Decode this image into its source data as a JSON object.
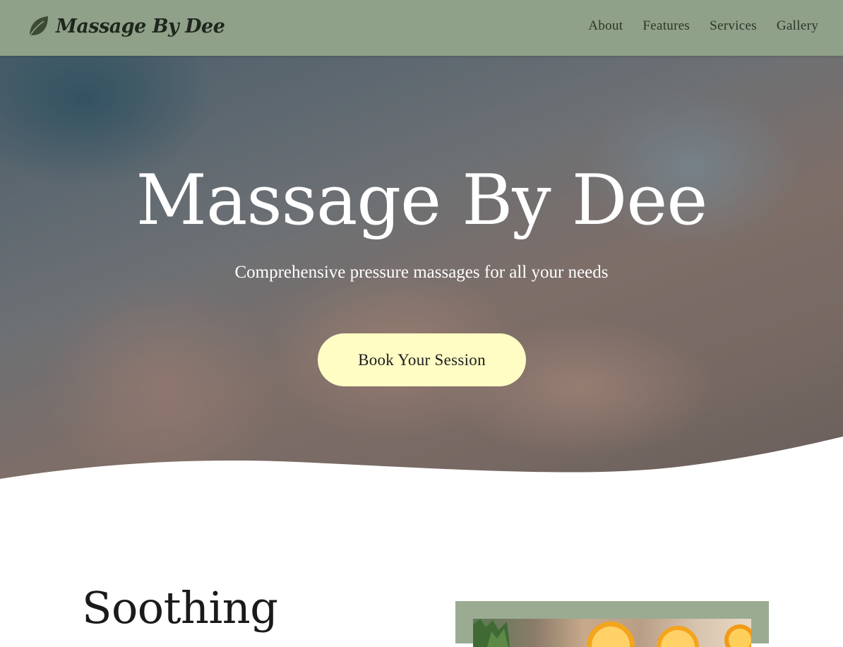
{
  "header": {
    "brand": "Massage By Dee",
    "logo_icon": "leaf-icon",
    "nav": [
      "About",
      "Features",
      "Services",
      "Gallery"
    ]
  },
  "hero": {
    "title": "Massage By Dee",
    "subtitle": "Comprehensive pressure massages for all your needs",
    "cta_label": "Book Your Session",
    "background_image": "massage-hands-photo"
  },
  "section": {
    "heading": "Soothing",
    "image": "spa-orange-slices-photo"
  },
  "colors": {
    "header_bg": "#8fa188",
    "cta_bg": "#fffcc4",
    "frame_bg": "#9aab92"
  }
}
